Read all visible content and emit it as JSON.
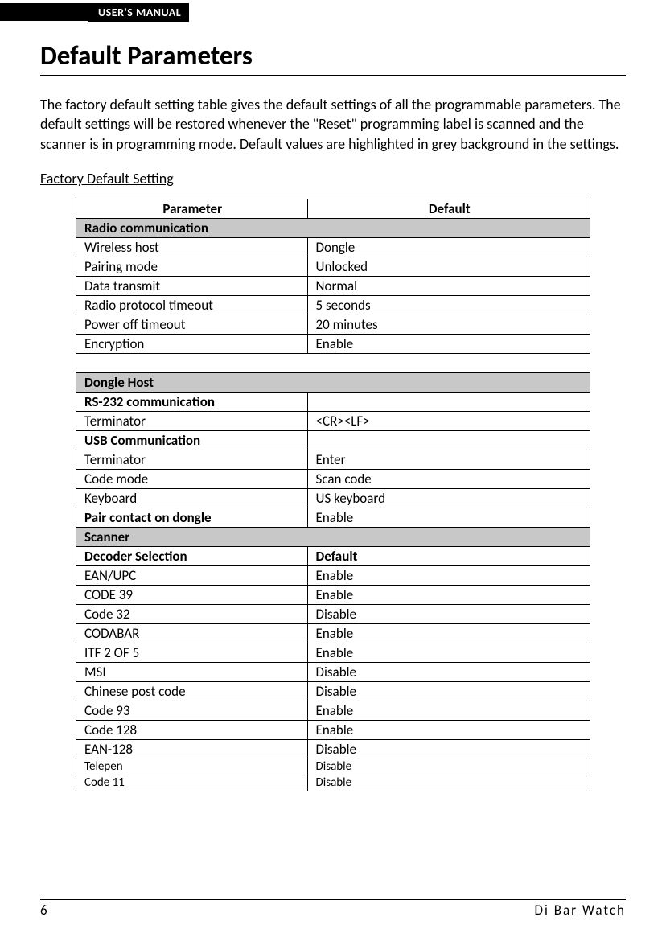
{
  "header": {
    "label": "USER'S MANUAL"
  },
  "title": "Default Parameters",
  "intro": "The factory default setting table gives the default settings of all the programmable parameters. The default settings will be restored whenever the \"Reset\" programming label is scanned and the scanner is in programming mode. Default values are highlighted in grey background in the settings.",
  "subhead": "Factory Default Setting",
  "table": {
    "head": {
      "param": "Parameter",
      "default": "Default"
    },
    "rows": [
      {
        "type": "section",
        "label": "Radio communication"
      },
      {
        "type": "data",
        "param": "Wireless host",
        "default": "Dongle"
      },
      {
        "type": "data",
        "param": "Pairing mode",
        "default": "Unlocked"
      },
      {
        "type": "data",
        "param": "Data transmit",
        "default": "Normal"
      },
      {
        "type": "data",
        "param": "Radio protocol timeout",
        "default": "5 seconds"
      },
      {
        "type": "data",
        "param": "Power off timeout",
        "default": "20 minutes"
      },
      {
        "type": "data",
        "param": "Encryption",
        "default": "Enable"
      },
      {
        "type": "empty"
      },
      {
        "type": "section",
        "label": "Dongle Host"
      },
      {
        "type": "data",
        "param": "RS-232 communication",
        "default": "",
        "boldParam": true
      },
      {
        "type": "data",
        "param": "Terminator",
        "default": "<CR><LF>"
      },
      {
        "type": "data",
        "param": "USB Communication",
        "default": "",
        "boldParam": true
      },
      {
        "type": "data",
        "param": "Terminator",
        "default": "Enter"
      },
      {
        "type": "data",
        "param": "Code mode",
        "default": "Scan code"
      },
      {
        "type": "data",
        "param": "Keyboard",
        "default": "US keyboard"
      },
      {
        "type": "data",
        "param": "Pair contact on dongle",
        "default": "Enable",
        "boldParam": true
      },
      {
        "type": "section",
        "label": "Scanner"
      },
      {
        "type": "data",
        "param": "Decoder Selection",
        "default": "Default",
        "boldParam": true,
        "boldDefault": true
      },
      {
        "type": "data",
        "param": "EAN/UPC",
        "default": "Enable"
      },
      {
        "type": "data",
        "param": "CODE 39",
        "default": "Enable"
      },
      {
        "type": "data",
        "param": "Code 32",
        "default": "Disable"
      },
      {
        "type": "data",
        "param": "CODABAR",
        "default": "Enable"
      },
      {
        "type": "data",
        "param": "ITF 2 OF 5",
        "default": "Enable"
      },
      {
        "type": "data",
        "param": "MSI",
        "default": "Disable"
      },
      {
        "type": "data",
        "param": "Chinese post code",
        "default": "Disable"
      },
      {
        "type": "data",
        "param": "Code 93",
        "default": "Enable"
      },
      {
        "type": "data",
        "param": "Code 128",
        "default": "Enable"
      },
      {
        "type": "data",
        "param": "EAN-128",
        "default": "Disable"
      },
      {
        "type": "data",
        "param": "Telepen",
        "default": "Disable",
        "small": true
      },
      {
        "type": "data",
        "param": "Code 11",
        "default": "Disable",
        "small": true
      }
    ]
  },
  "footer": {
    "page": "6",
    "product": "Di  Bar  Watch"
  }
}
